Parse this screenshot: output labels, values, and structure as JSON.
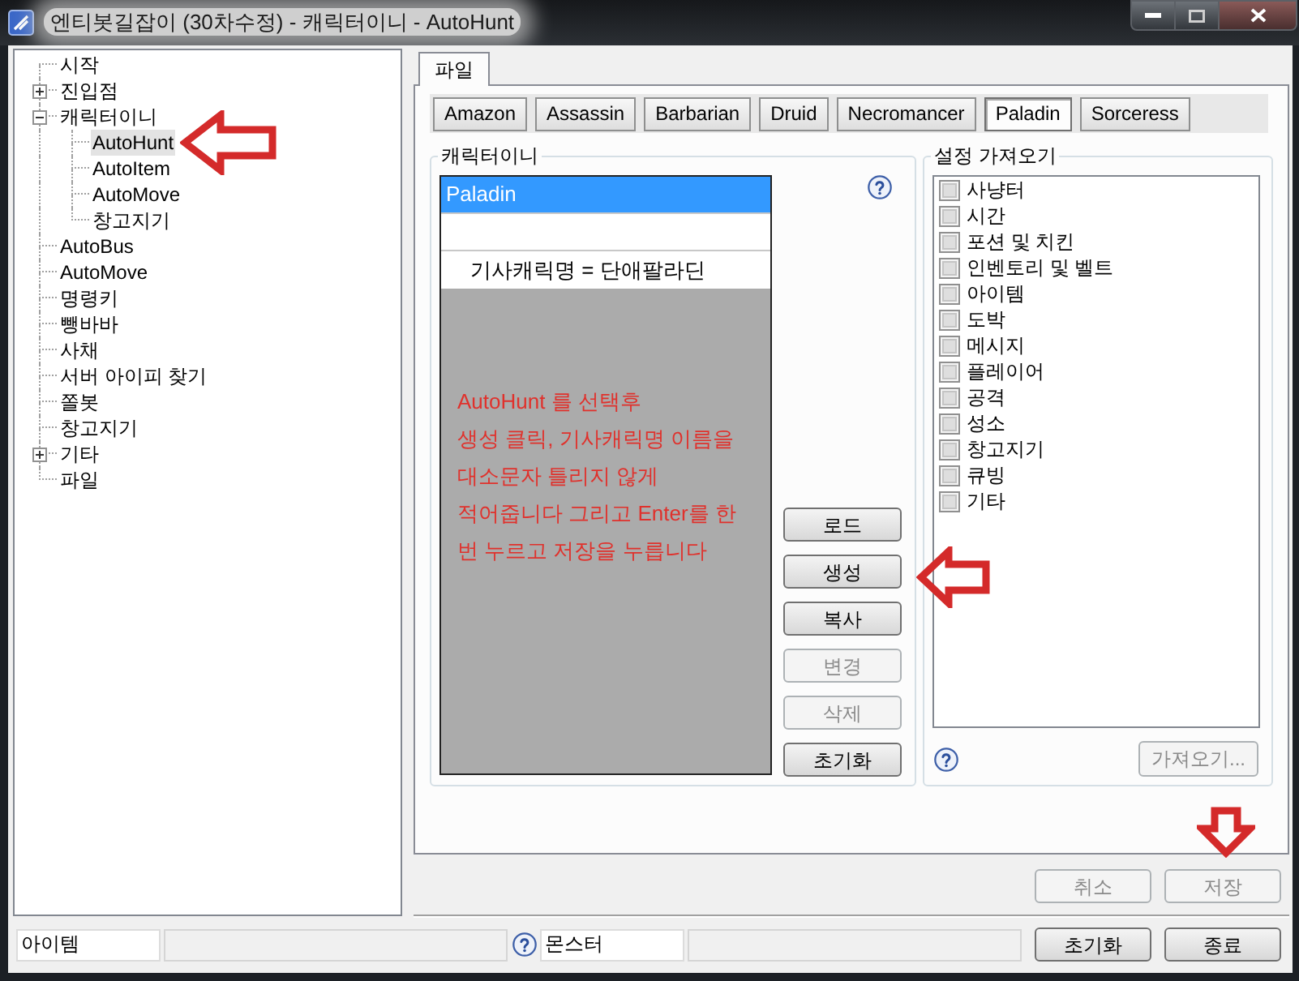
{
  "window": {
    "title": "엔티봇길잡이 (30차수정) - 캐릭터이니 - AutoHunt"
  },
  "tree": [
    {
      "label": "시작",
      "kind": "leaf",
      "selected": false
    },
    {
      "label": "진입점",
      "kind": "folder",
      "expanded": false,
      "selected": false
    },
    {
      "label": "캐릭터이니",
      "kind": "folder",
      "expanded": true,
      "selected": false,
      "children": [
        {
          "label": "AutoHunt",
          "kind": "leaf",
          "selected": true
        },
        {
          "label": "AutoItem",
          "kind": "leaf",
          "selected": false
        },
        {
          "label": "AutoMove",
          "kind": "leaf",
          "selected": false
        },
        {
          "label": "창고지기",
          "kind": "leaf",
          "selected": false
        }
      ]
    },
    {
      "label": "AutoBus",
      "kind": "leaf",
      "selected": false
    },
    {
      "label": "AutoMove",
      "kind": "leaf",
      "selected": false
    },
    {
      "label": "명령키",
      "kind": "leaf",
      "selected": false
    },
    {
      "label": "뺑바바",
      "kind": "leaf",
      "selected": false
    },
    {
      "label": "사채",
      "kind": "leaf",
      "selected": false
    },
    {
      "label": "서버 아이피 찾기",
      "kind": "leaf",
      "selected": false
    },
    {
      "label": "쫄봇",
      "kind": "leaf",
      "selected": false
    },
    {
      "label": "창고지기",
      "kind": "leaf",
      "selected": false
    },
    {
      "label": "기타",
      "kind": "folder",
      "expanded": false,
      "selected": false
    },
    {
      "label": "파일",
      "kind": "leaf",
      "selected": false
    }
  ],
  "tabs": [
    {
      "label": "파일",
      "selected": true
    }
  ],
  "class_tabs": [
    {
      "label": "Amazon",
      "selected": false
    },
    {
      "label": "Assassin",
      "selected": false
    },
    {
      "label": "Barbarian",
      "selected": false
    },
    {
      "label": "Druid",
      "selected": false
    },
    {
      "label": "Necromancer",
      "selected": false
    },
    {
      "label": "Paladin",
      "selected": true
    },
    {
      "label": "Sorceress",
      "selected": false
    }
  ],
  "character_group": {
    "title": "캐릭터이니",
    "rows": [
      {
        "kind": "character",
        "text": "Paladin",
        "selected": true
      },
      {
        "kind": "blank",
        "selected": false
      },
      {
        "kind": "setting",
        "text": "기사캐릭명 = 단애팔라딘",
        "selected": false
      }
    ],
    "note": [
      "AutoHunt 를 선택후",
      "생성 클릭, 기사캐릭명 이름을",
      "대소문자 틀리지 않게",
      "적어줍니다 그리고 Enter를 한",
      "번 누르고 저장을 누릅니다"
    ],
    "buttons": [
      {
        "label": "로드",
        "disabled": false
      },
      {
        "label": "생성",
        "disabled": false
      },
      {
        "label": "복사",
        "disabled": false
      },
      {
        "label": "변경",
        "disabled": true
      },
      {
        "label": "삭제",
        "disabled": true
      },
      {
        "label": "초기화",
        "disabled": false
      }
    ]
  },
  "import_group": {
    "title": "설정 가져오기",
    "items": [
      {
        "label": "사냥터",
        "checked": false
      },
      {
        "label": "시간",
        "checked": false
      },
      {
        "label": "포션 및 치킨",
        "checked": false
      },
      {
        "label": "인벤토리 및 벨트",
        "checked": false
      },
      {
        "label": "아이템",
        "checked": false
      },
      {
        "label": "도박",
        "checked": false
      },
      {
        "label": "메시지",
        "checked": false
      },
      {
        "label": "플레이어",
        "checked": false
      },
      {
        "label": "공격",
        "checked": false
      },
      {
        "label": "성소",
        "checked": false
      },
      {
        "label": "창고지기",
        "checked": false
      },
      {
        "label": "큐빙",
        "checked": false
      },
      {
        "label": "기타",
        "checked": false
      }
    ],
    "button": {
      "label": "가져오기...",
      "disabled": true
    }
  },
  "dialog_buttons": [
    {
      "label": "취소",
      "disabled": true
    },
    {
      "label": "저장",
      "disabled": true
    }
  ],
  "bottom_bar": {
    "fields": [
      {
        "label": "아이템",
        "help": false,
        "value_disabled": true
      },
      {
        "label": "몬스터",
        "help": true,
        "value_disabled": true
      }
    ],
    "buttons": [
      {
        "label": "초기화",
        "disabled": false
      },
      {
        "label": "종료",
        "disabled": false
      }
    ]
  }
}
